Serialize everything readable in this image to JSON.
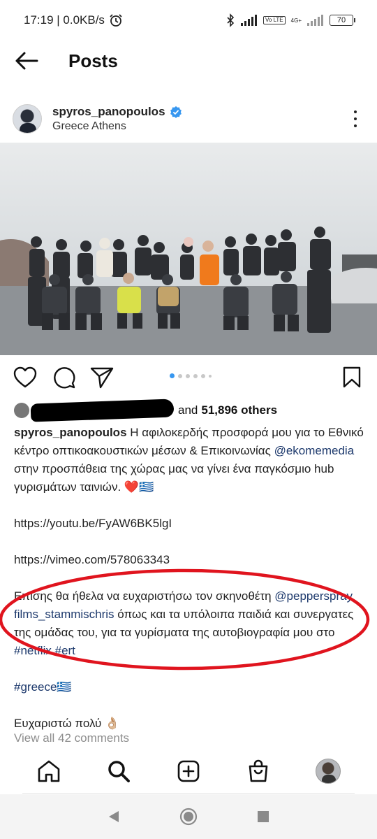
{
  "status_bar": {
    "time_speed": "17:19 | 0.0KB/s",
    "volte": "Vo LTE",
    "network": "4G+",
    "battery": "70"
  },
  "header": {
    "title": "Posts",
    "back_icon": "arrow-left-icon"
  },
  "post": {
    "username": "spyros_panopoulos",
    "location": "Greece Athens",
    "verified": true,
    "likes": {
      "and_text": "and",
      "count_text": "51,896 others"
    },
    "caption": {
      "username": "spyros_panopoulos",
      "paragraph1_text": " Η αφιλοκερδής προσφορά μου για το Εθνικό κέντρο οπτικοακουστικών μέσων & Επικοινωνίας ",
      "mention1": "@ekomemedia",
      "paragraph1_tail": " στην προσπάθεια της χώρας μας να γίνει ένα παγκόσμιο hub γυρισμάτων ταινιών. ❤️🇬🇷",
      "link_youtube": "https://youtu.be/FyAW6BK5lgI",
      "link_vimeo": "https://vimeo.com/578063343",
      "paragraph2_head": "Επίσης θα ήθελα να ευχαριστήσω τον σκηνοθέτη ",
      "mention2": "@pepperspray films_stammischris",
      "paragraph2_mid": " όπως και τα υπόλοιπα παιδιά και συνεργατες της ομάδας του, για τα γυρίσματα της αυτοβιογραφία μου στο ",
      "hashtag_netflix": "#netflix",
      "hashtag_ert": "#ert",
      "hashtag_greece": "#greece🇬🇷",
      "thanks": "Ευχαριστώ πολύ 👌🏼"
    },
    "view_comments": "View all 42 comments",
    "carousel": {
      "count": 6,
      "active": 0
    }
  },
  "colors": {
    "accent_blue": "#3797f0",
    "link": "#1e3a6d",
    "annotation_red": "#e0141e",
    "like_red": "#e0245e"
  }
}
